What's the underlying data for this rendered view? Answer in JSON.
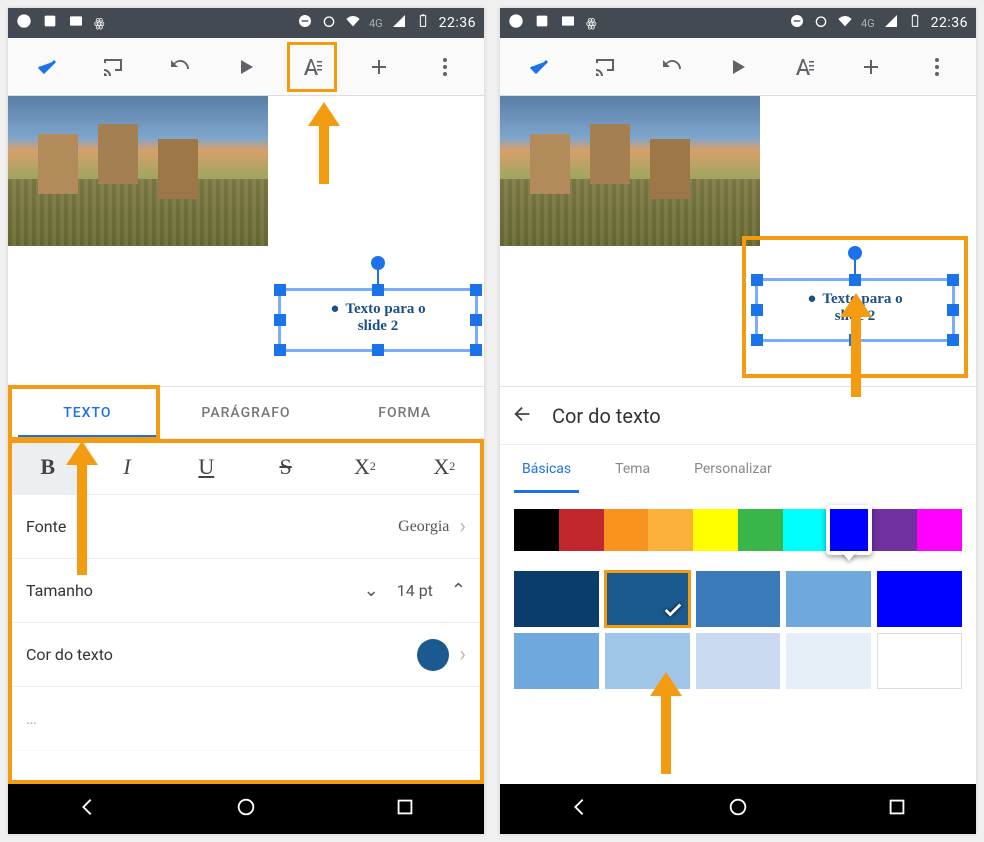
{
  "status": {
    "time": "22:36",
    "network": "4G"
  },
  "textbox": {
    "line1": "Texto para o",
    "line2": "slide 2"
  },
  "left": {
    "tabs": {
      "texto": "TEXTO",
      "paragrafo": "PARÁGRAFO",
      "forma": "FORMA"
    },
    "fmt": {
      "bold": "B",
      "italic": "I",
      "under": "U",
      "strike": "S",
      "sup": "X",
      "sub": "X"
    },
    "rows": {
      "fonte_label": "Fonte",
      "fonte_value": "Georgia",
      "tamanho_label": "Tamanho",
      "tamanho_value": "14 pt",
      "cor_label": "Cor do texto",
      "cor_value": "#1a5a8f"
    }
  },
  "right": {
    "header_title": "Cor do texto",
    "tabs": {
      "basicas": "Básicas",
      "tema": "Tema",
      "personalizar": "Personalizar"
    },
    "strip_colors": [
      "#000000",
      "#c1272d",
      "#f7931e",
      "#fbb03b",
      "#ffff00",
      "#39b54a",
      "#00ffff",
      "#0000ff",
      "#7030a0",
      "#ff00ff"
    ],
    "strip_selected_index": 7,
    "swatches_row1": [
      "#0b3d6b",
      "#1a5a8f",
      "#3b7ab8",
      "#6fa8dc",
      "#0000ff"
    ],
    "swatches_row2": [
      "#6fa8dc",
      "#9fc5e8",
      "#c9daf0",
      "#e6eef8",
      "#ffffff"
    ],
    "selected_swatch": "#1a5a8f"
  }
}
